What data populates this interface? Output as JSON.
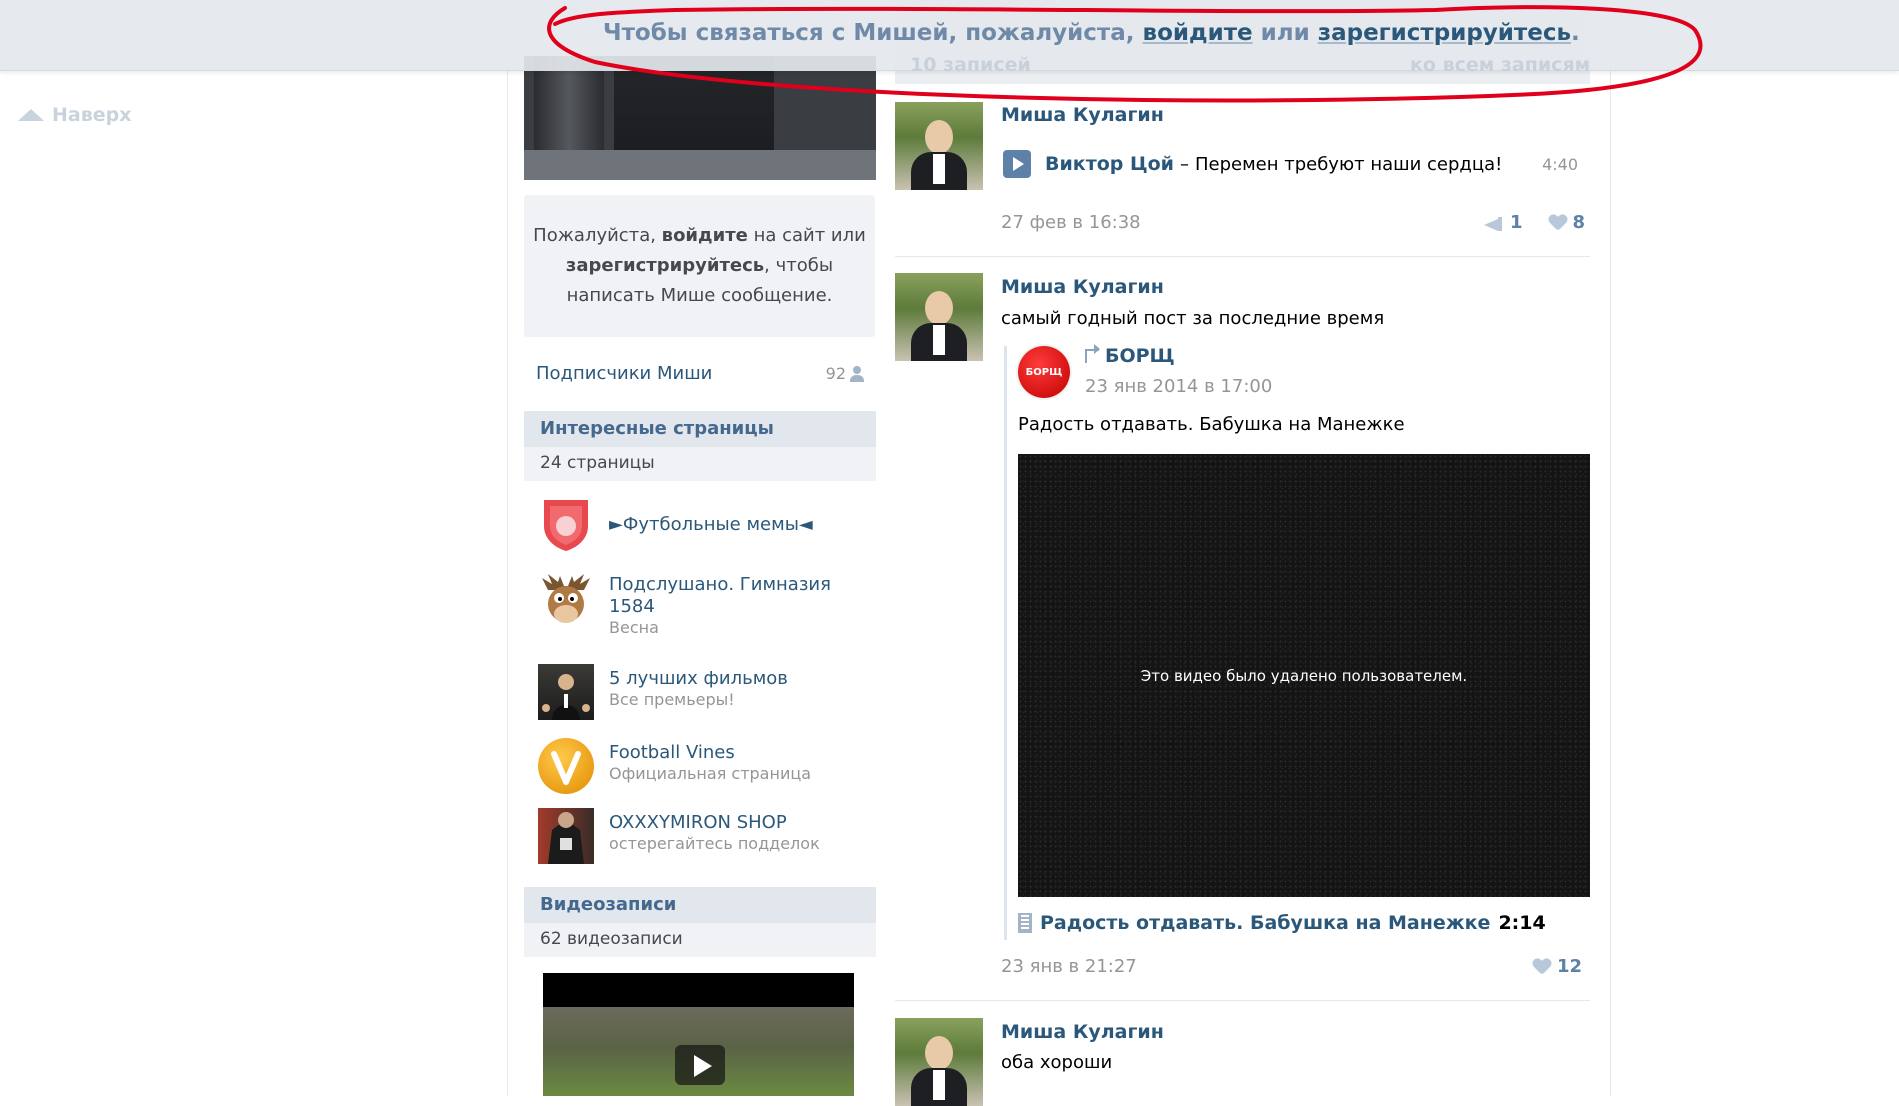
{
  "nav": {
    "scroll_up": "Наверх"
  },
  "banner": {
    "prefix": "Чтобы связаться с Мишей, пожалуйста, ",
    "login": "войдите",
    "or": " или ",
    "register": "зарегистрируйтесь",
    "suffix": ".",
    "ghost_left": "10 записей",
    "ghost_right": "ко всем записям"
  },
  "sidebar": {
    "login_box": {
      "line1_pre": "Пожалуйста, ",
      "line1_bold": "войдите",
      "line1_post": " на сайт или",
      "line2_bold": "зарегистрируйтесь",
      "line2_post": ", чтобы",
      "line3": "написать Мише сообщение."
    },
    "subscribers": {
      "label": "Подписчики Миши",
      "count": "92"
    },
    "interesting": {
      "title": "Интересные страницы",
      "subtitle": "24 страницы",
      "items": [
        {
          "name": "►Футбольные мемы◄",
          "desc": ""
        },
        {
          "name": "Подслушано. Гимназия 1584",
          "desc": "Весна"
        },
        {
          "name": "5 лучших фильмов",
          "desc": "Все премьеры!"
        },
        {
          "name": "Football Vines",
          "desc": "Официальная страница"
        },
        {
          "name": "OXXXYMIRON SHOP",
          "desc": "остерегайтесь подделок"
        }
      ]
    },
    "videos": {
      "title": "Видеозаписи",
      "subtitle": "62 видеозаписи"
    }
  },
  "wall": {
    "posts": [
      {
        "author": "Миша Кулагин",
        "audio": {
          "artist": "Виктор Цой",
          "dash": "–",
          "title": "Перемен требуют наши сердца!",
          "duration": "4:40"
        },
        "date": "27 фев в 16:38",
        "shares": "1",
        "likes": "8"
      },
      {
        "author": "Миша Кулагин",
        "text": "самый годный пост за последние время",
        "repost": {
          "logo_text": "БОРЩ",
          "author": "БОРЩ",
          "date": "23 янв 2014 в 17:00",
          "text": "Радость отдавать. Бабушка на Манежке",
          "video_removed": "Это видео было удалено пользователем.",
          "video_title": "Радость отдавать. Бабушка на Манежке",
          "video_duration": "2:14"
        },
        "date": "23 янв в 21:27",
        "likes": "12"
      },
      {
        "author": "Миша Кулагин",
        "text": "оба хороши"
      }
    ]
  },
  "colors": {
    "link": "#2b587a",
    "accent": "#5e81a8",
    "annotation": "#e0001b"
  }
}
